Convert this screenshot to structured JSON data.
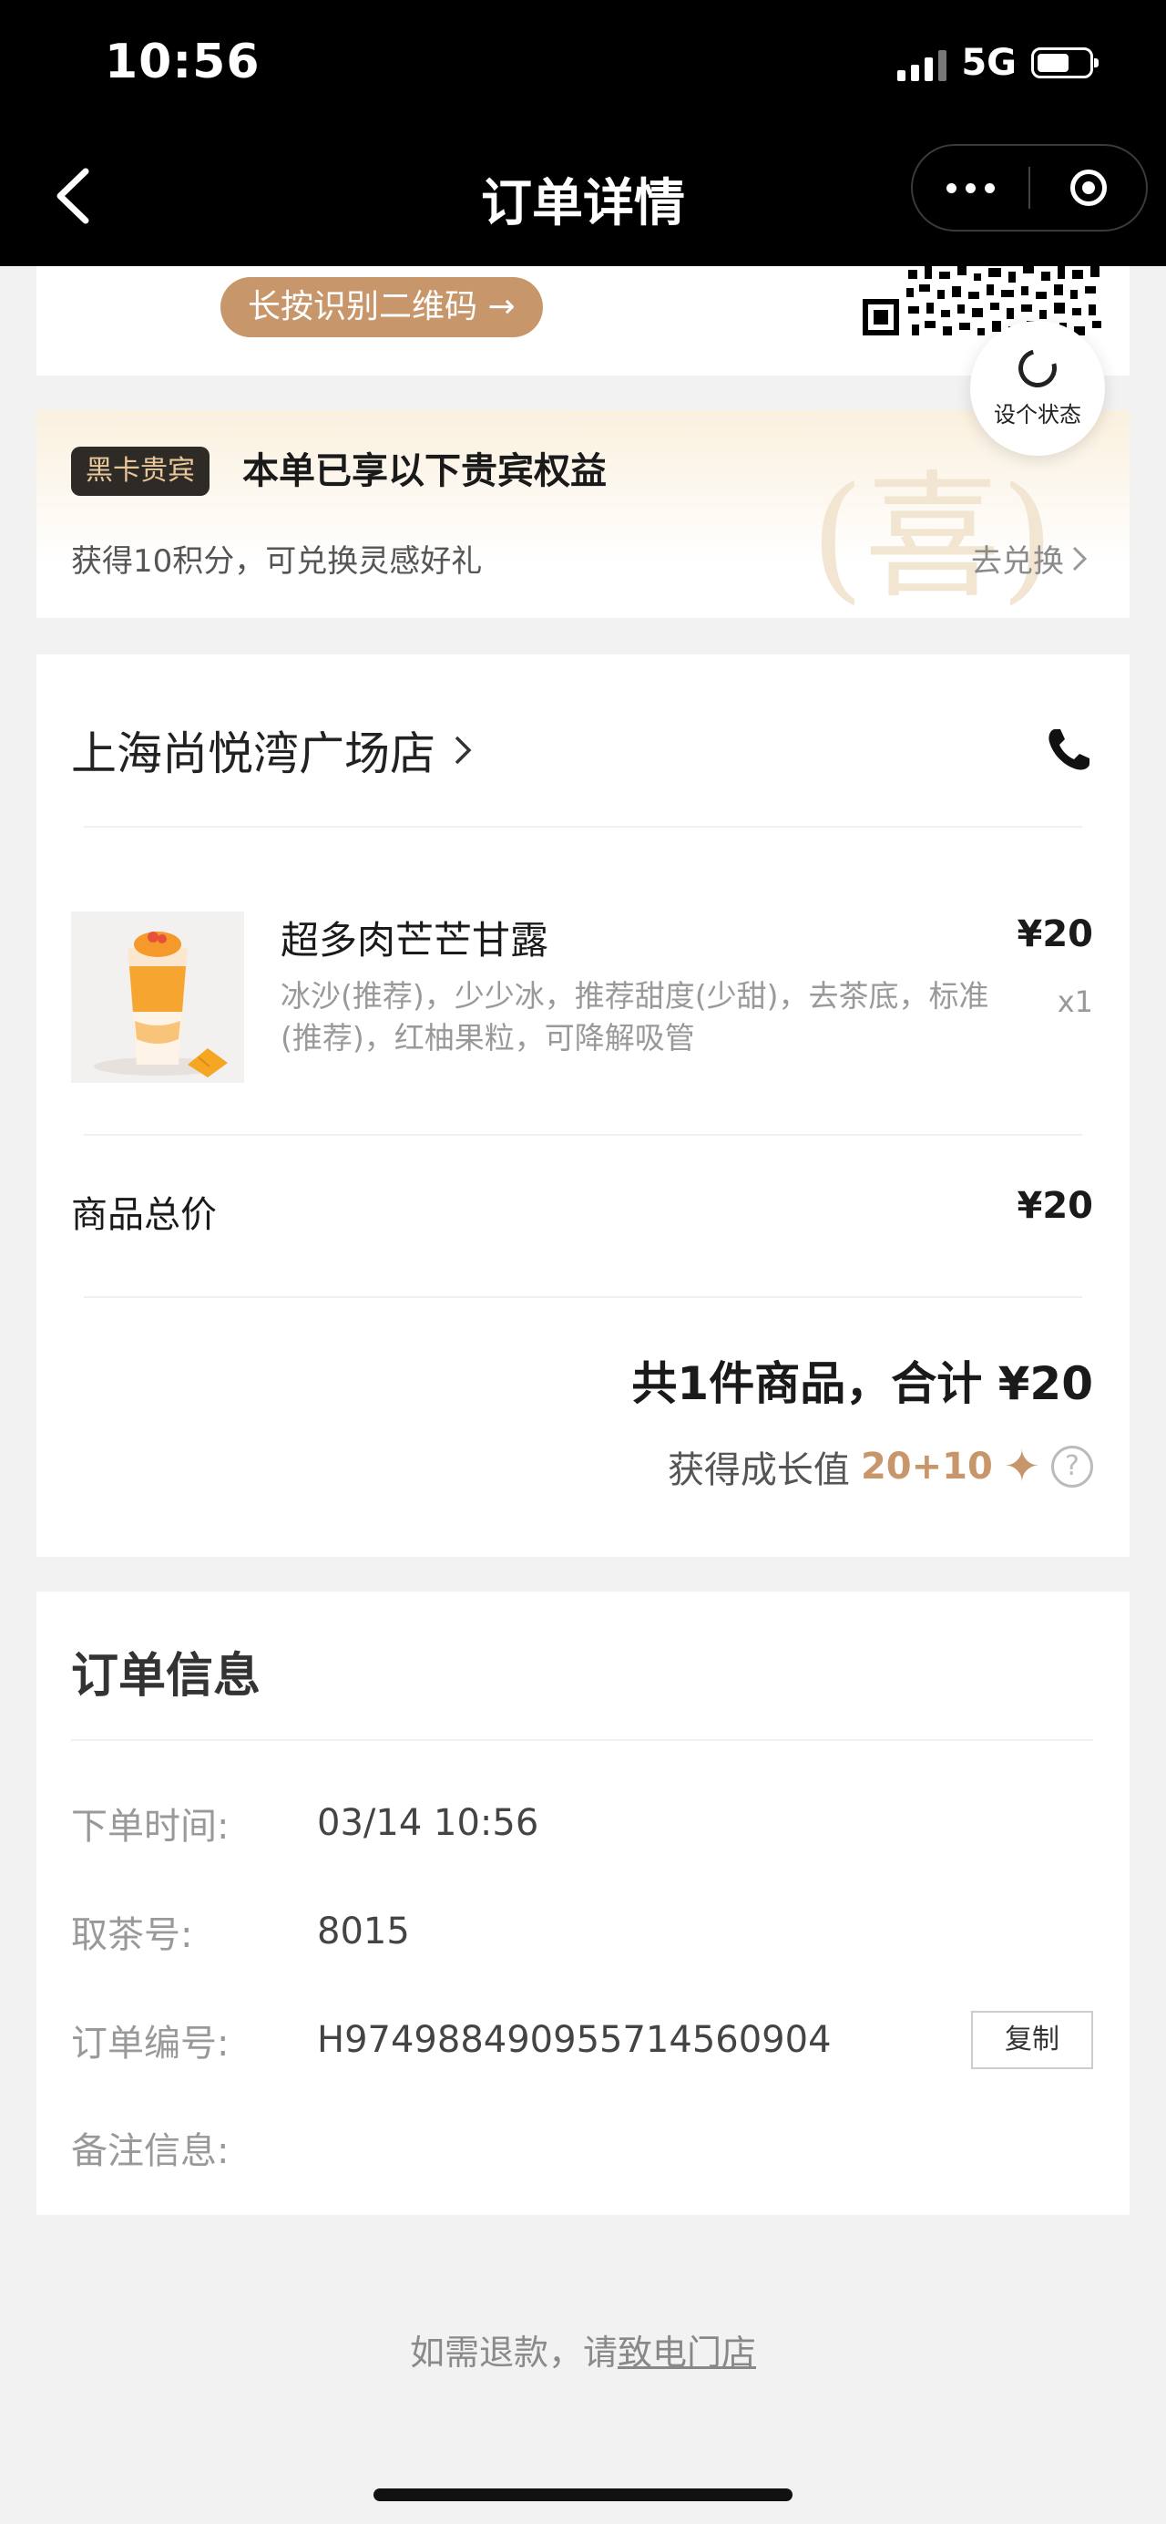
{
  "status_bar": {
    "time": "10:56",
    "network": "5G"
  },
  "nav": {
    "title": "订单详情"
  },
  "qr_section": {
    "button_label": "长按识别二维码 →"
  },
  "status_fab": {
    "label": "设个状态"
  },
  "vip": {
    "badge": "黑卡贵宾",
    "title": "本单已享以下贵宾权益",
    "subtitle": "获得10积分，可兑换灵感好礼",
    "redeem_label": "去兑换",
    "watermark": "(喜)"
  },
  "order": {
    "store_name": "上海尚悦湾广场店",
    "item": {
      "name": "超多肉芒芒甘露",
      "price": "¥20",
      "description": "冰沙(推荐)，少少冰，推荐甜度(少甜)，去茶底，标准(推荐)，红柚果粒，可降解吸管",
      "quantity": "x1"
    },
    "subtotal_label": "商品总价",
    "subtotal_value": "¥20",
    "summary": "共1件商品，合计 ¥20",
    "growth_label": "获得成长值",
    "growth_value": "20+10"
  },
  "order_info": {
    "title": "订单信息",
    "rows": [
      {
        "label": "下单时间:",
        "value": "03/14 10:56"
      },
      {
        "label": "取茶号:",
        "value": "8015"
      },
      {
        "label": "订单编号:",
        "value": "H974988490955714560904"
      },
      {
        "label": "备注信息:",
        "value": ""
      }
    ],
    "copy_label": "复制"
  },
  "footer": {
    "refund_prefix": "如需退款，请",
    "refund_link": "致电门店"
  },
  "colors": {
    "accent": "#c8966b",
    "vip_badge_bg": "#2e2a26",
    "vip_badge_text": "#e8c89a"
  },
  "icons": [
    "back-icon",
    "more-icon",
    "close-miniprogram-icon",
    "refresh-icon",
    "chevron-right-icon",
    "phone-icon",
    "star-icon",
    "help-icon"
  ]
}
